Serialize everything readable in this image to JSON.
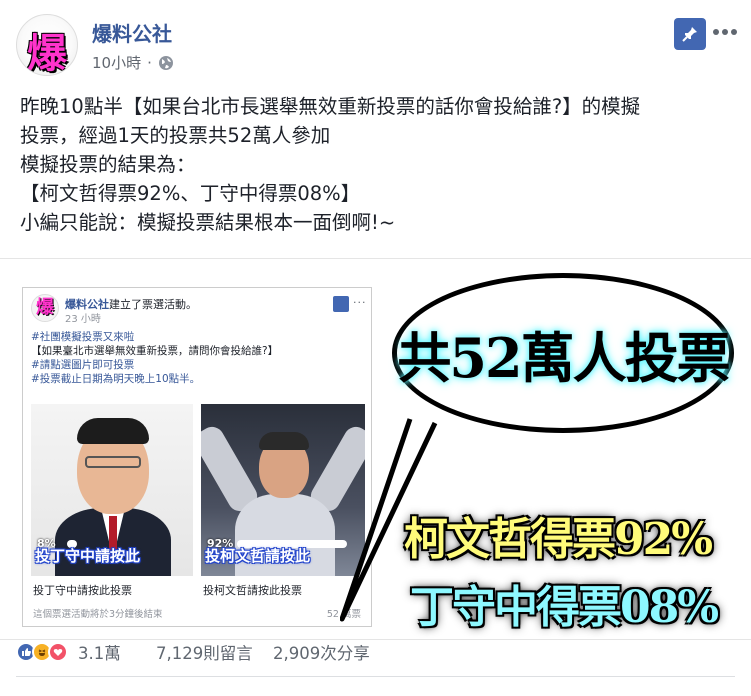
{
  "header": {
    "page_name": "爆料公社",
    "avatar_text": "爆",
    "time": "10小時",
    "separator": "·"
  },
  "post": {
    "lines": [
      "昨晚10點半【如果台北市長選舉無效重新投票的話你會投給誰?】的模擬",
      "投票，經過1天的投票共52萬人參加",
      "模擬投票的結果為：",
      "【柯文哲得票92%、丁守中得票08%】",
      "小編只能說：模擬投票結果根本一面倒啊!~"
    ]
  },
  "image": {
    "embed": {
      "avatar_text": "爆",
      "page_name": "爆料公社",
      "action": "建立了票選活動。",
      "time": "23 小時",
      "more": "···",
      "lines": [
        "#社團模擬投票又來啦",
        "【如果臺北市選舉無效重新投票，請問你會投給誰?】",
        "#請點選圖片即可投票",
        "#投票截止日期為明天晚上10點半。"
      ],
      "left_overlay": "投丁守中請按此",
      "left_pct": "8%",
      "left_fraction": 0.08,
      "right_overlay": "投柯文哲請按此",
      "right_pct": "92%",
      "right_fraction": 0.92,
      "left_caption": "投丁守中請按此投票",
      "right_caption": "投柯文哲請按此投票",
      "footer": "這個票選活動將於3分鐘後結束",
      "votes": "52 萬票"
    },
    "bubble_text": "共52萬人投票",
    "result1": "柯文哲得票92%",
    "result2": "丁守中得票08%"
  },
  "reactions": {
    "count": "3.1萬",
    "comments": "7,129則留言",
    "shares": "2,909次分享"
  },
  "colors": {
    "link_blue": "#385898",
    "fb_blue": "#4267b2",
    "bubble_glow": "#5ef6ff",
    "result1": "#fffb7a",
    "result2": "#8df8ff"
  },
  "icons": [
    "globe-icon",
    "pin-icon",
    "more-icon",
    "like-icon",
    "haha-icon",
    "love-icon"
  ]
}
